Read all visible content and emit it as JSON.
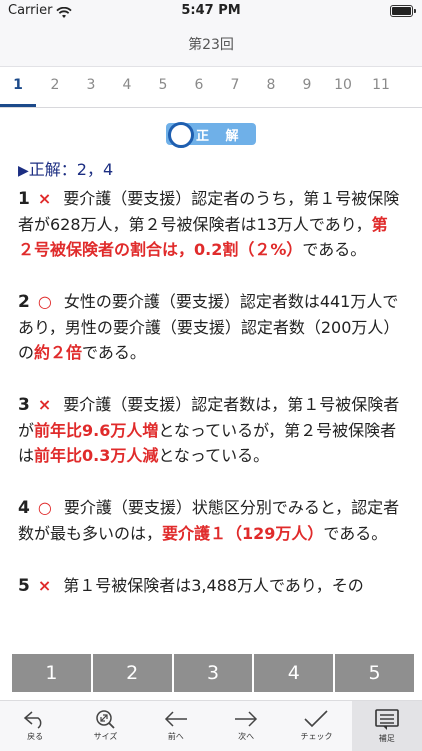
{
  "status_bar": {
    "carrier": "Carrier",
    "time": "5:47 PM"
  },
  "nav": {
    "title": "第23回"
  },
  "tabs": [
    "1",
    "2",
    "3",
    "4",
    "5",
    "6",
    "7",
    "8",
    "9",
    "10",
    "11"
  ],
  "active_tab_index": 0,
  "banner": {
    "label": "正 解"
  },
  "answer": {
    "prefix": "▶",
    "label": "正解：",
    "value": "2，4"
  },
  "items": [
    {
      "num": "1",
      "mark": "×",
      "segments": [
        {
          "text": "要介護（要支援）認定者のうち，第１号被保険者が628万人，第２号被保険者は13万人であり，",
          "red": false
        },
        {
          "text": "第２号被保険者の割合は，0.2割（２%）",
          "red": true
        },
        {
          "text": "である。",
          "red": false
        }
      ]
    },
    {
      "num": "2",
      "mark": "○",
      "segments": [
        {
          "text": "女性の要介護（要支援）認定者数は441万人であり，男性の要介護（要支援）認定者数（200万人）の",
          "red": false
        },
        {
          "text": "約２倍",
          "red": true
        },
        {
          "text": "である。",
          "red": false
        }
      ]
    },
    {
      "num": "3",
      "mark": "×",
      "segments": [
        {
          "text": "要介護（要支援）認定者数は，第１号被保険者が",
          "red": false
        },
        {
          "text": "前年比9.6万人増",
          "red": true
        },
        {
          "text": "となっているが，第２号被保険者は",
          "red": false
        },
        {
          "text": "前年比0.3万人減",
          "red": true
        },
        {
          "text": "となっている。",
          "red": false
        }
      ]
    },
    {
      "num": "4",
      "mark": "○",
      "segments": [
        {
          "text": "要介護（要支援）状態区分別でみると，認定者数が最も多いのは，",
          "red": false
        },
        {
          "text": "要介護１（129万人）",
          "red": true
        },
        {
          "text": "である。",
          "red": false
        }
      ]
    },
    {
      "num": "5",
      "mark": "×",
      "segments": [
        {
          "text": "第１号被保険者は3,488万人であり，その",
          "red": false
        }
      ]
    }
  ],
  "answer_buttons": [
    "1",
    "2",
    "3",
    "4",
    "5"
  ],
  "toolbar": [
    {
      "label": "戻る",
      "icon": "back-arrow-icon"
    },
    {
      "label": "サイズ",
      "icon": "zoom-icon"
    },
    {
      "label": "前へ",
      "icon": "left-arrow-icon"
    },
    {
      "label": "次へ",
      "icon": "right-arrow-icon"
    },
    {
      "label": "チェック",
      "icon": "check-icon"
    },
    {
      "label": "補足",
      "icon": "notes-icon"
    }
  ],
  "colors": {
    "accent": "#1c4a8a",
    "correct_red": "#e02b2b",
    "banner": "#6fb0e8",
    "answer_button": "#8f8f8f"
  }
}
